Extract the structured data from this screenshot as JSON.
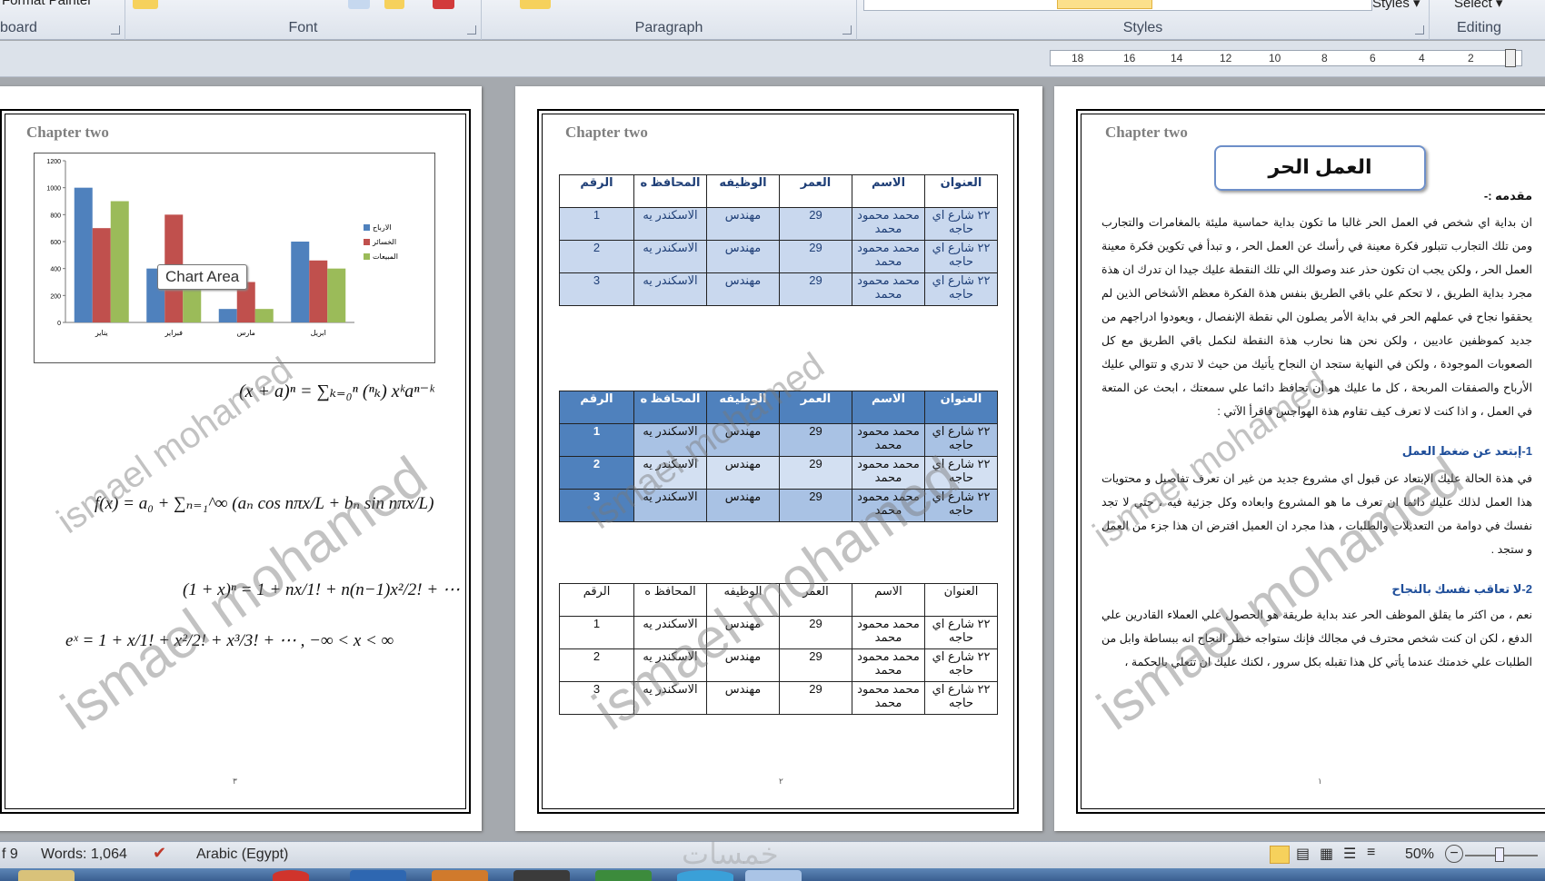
{
  "ribbon": {
    "format_painter": "Format Painter",
    "groups": {
      "clipboard": "board",
      "font": "Font",
      "paragraph": "Paragraph",
      "styles": "Styles",
      "editing": "Editing"
    },
    "styles_button": "Styles ▾",
    "select_button": "Select ▾"
  },
  "ruler": {
    "labels": [
      "18",
      "16",
      "14",
      "12",
      "10",
      "8",
      "6",
      "4",
      "2"
    ]
  },
  "pages": {
    "chapter_heading": "Chapter two",
    "page_numbers": [
      "٣",
      "٢",
      "١"
    ]
  },
  "watermark": {
    "line1": "ismael mohamed",
    "line2": "ismael mohamed"
  },
  "chart": {
    "tooltip": "Chart Area",
    "colors": {
      "blue": "#4f81bd",
      "red": "#c0504d",
      "green": "#9bbb59"
    }
  },
  "chart_data": {
    "type": "bar",
    "categories": [
      "يناير",
      "فبراير",
      "مارس",
      "ابريل"
    ],
    "series": [
      {
        "name": "الارباح",
        "values": [
          1000,
          400,
          100,
          600
        ]
      },
      {
        "name": "الخسائر",
        "values": [
          700,
          800,
          300,
          460
        ]
      },
      {
        "name": "المبيعات",
        "values": [
          900,
          300,
          100,
          400
        ]
      }
    ],
    "ylim": [
      0,
      1200
    ],
    "yticks": [
      0,
      200,
      400,
      600,
      800,
      1000,
      1200
    ],
    "grid": false,
    "legend": "right"
  },
  "equations": {
    "binomial": "(x + a)ⁿ = ∑ₖ₌₀ⁿ (ⁿₖ) xᵏaⁿ⁻ᵏ",
    "fourier": "f(x) = a₀ + ∑ₙ₌₁^∞ (aₙ cos nπx/L + bₙ sin nπx/L)",
    "expansion": "(1 + x)ⁿ = 1 + nx/1! + n(n−1)x²/2! + ⋯",
    "exponential": "eˣ = 1 + x/1! + x²/2! + x³/3! + ⋯ ,      −∞ < x < ∞"
  },
  "tables": {
    "headers": [
      "العنوان",
      "الاسم",
      "العمر",
      "الوظيفه",
      "المحافظ ه",
      "الرقم"
    ],
    "rows": [
      [
        "٢٢ شارع اي حاجه",
        "محمد محمود محمد",
        "29",
        "مهندس",
        "الاسكندر يه",
        "1"
      ],
      [
        "٢٢ شارع اي حاجه",
        "محمد محمود محمد",
        "29",
        "مهندس",
        "الاسكندر يه",
        "2"
      ],
      [
        "٢٢ شارع اي حاجه",
        "محمد محمود محمد",
        "29",
        "مهندس",
        "الاسكندر يه",
        "3"
      ]
    ]
  },
  "article": {
    "title": "العمل الحر",
    "intro_label": "مقدمه :-",
    "intro": "ان بداية اي شخص في العمل الحر غالبا ما تكون بداية حماسية مليئة بالمغامرات والتجارب ومن تلك التجارب تتبلور فكرة معينة في رأسك عن العمل الحر ، و تبدأ في تكوين فكرة معينة العمل الحر ، ولكن يجب ان تكون حذر عند وصولك الي تلك النقطة عليك جيدا ان تدرك ان هذة مجرد بداية الطريق ، لا تحكم علي باقي الطريق بنفس هذة الفكرة معظم الأشخاص الذين لم يحققوا نجاح في عملهم الحر في بداية الأمر يصلون الي نقطة الإنفصال ، ويعودوا ادراجهم من جديد كموظفين عاديين ، ولكن نحن هنا نحارب هذة النقطة لنكمل باقي الطريق مع كل الصعوبات الموجودة ، ولكن في النهاية ستجد ان النجاح يأتيك من حيث لا تدري و تتوالي عليك الأرباح والصفقات المربحة ، كل ما عليك هو أن تحافظ دائما علي سمعتك ، ابحث عن المتعة في العمل ، و اذا كنت لا تعرف كيف تقاوم هذة الهواجس فاقرأ الآتي :",
    "h1": "1-إبتعد عن ضغط العمل",
    "p1": "في هذة الحالة عليك الإبتعاد عن قبول اي مشروع جديد من غير ان تعرف تفاصيل و محتويات هذا العمل لذلك عليك دائما ان تعرف ما هو المشروع وابعاده وكل جزئية فيه ، حتي لا تجد نفسك في دوامة من التعديلات والطلبات ، هذا مجرد ان العميل افترض ان هذا جزء من العمل و ستجد .",
    "h2": "2-لا تعاقب نفسك بالنجاح",
    "p2": "نعم ، من اكثر ما يقلق الموظف الحر عند بداية طريقة هو الحصول علي العملاء القادرين علي الدفع ، لكن ان كنت شخص محترف في مجالك فإنك ستواجه خطر النجاح انه ببساطة وابل من الطلبات علي خدمتك عندما يأتي كل هذا تقبله بكل سرور ، لكنك عليك ان تتعلي بالحكمة ،"
  },
  "status": {
    "page": "f 9",
    "words": "Words: 1,064",
    "language": "Arabic (Egypt)",
    "zoom": "50%",
    "footer_watermark": "خمسات"
  }
}
